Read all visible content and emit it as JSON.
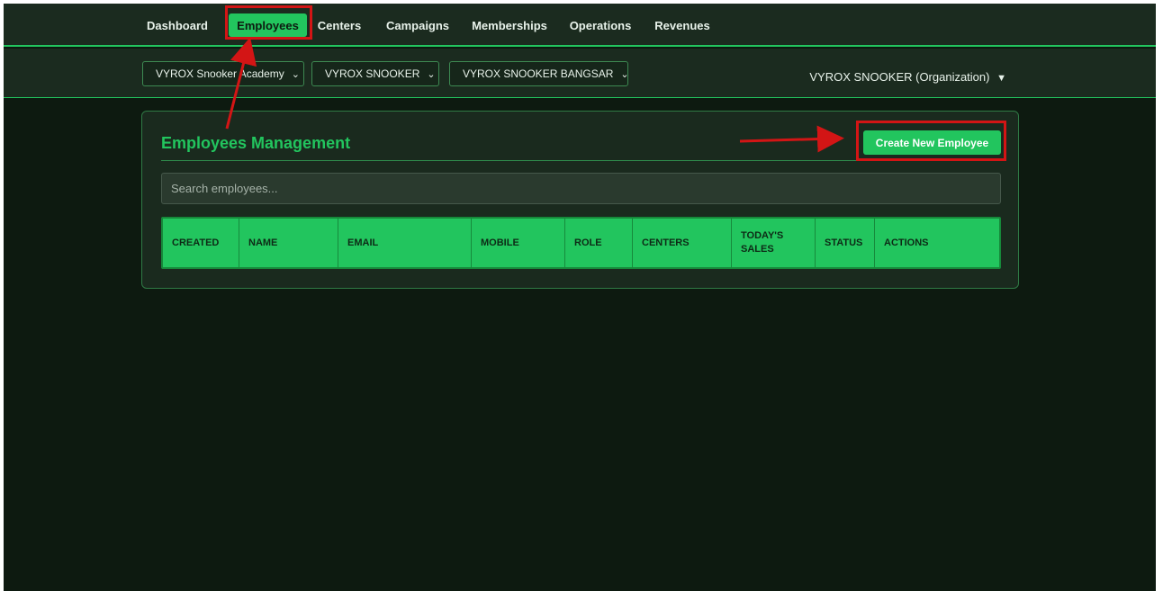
{
  "nav": {
    "items": [
      {
        "label": "Dashboard"
      },
      {
        "label": "Employees"
      },
      {
        "label": "Centers"
      },
      {
        "label": "Campaigns"
      },
      {
        "label": "Memberships"
      },
      {
        "label": "Operations"
      },
      {
        "label": "Revenues"
      }
    ],
    "active_item": "Employees"
  },
  "filters": {
    "academy": "VYROX Snooker Academy",
    "organization": "VYROX SNOOKER",
    "center": "VYROX SNOOKER BANGSAR"
  },
  "org_menu": {
    "label": "VYROX SNOOKER (Organization)",
    "caret": "▼"
  },
  "panel": {
    "title": "Employees Management",
    "create_button": "Create New Employee",
    "search_placeholder": "Search employees..."
  },
  "table": {
    "columns": [
      "CREATED",
      "NAME",
      "EMAIL",
      "MOBILE",
      "ROLE",
      "CENTERS",
      "TODAY'S SALES",
      "STATUS",
      "ACTIONS"
    ],
    "rows": []
  },
  "colors": {
    "accent": "#22c55e",
    "background": "#0d1a10",
    "annotation": "#d31515"
  },
  "icons": {
    "dropdown": "chevron-down-icon",
    "org_caret": "caret-down-icon"
  }
}
